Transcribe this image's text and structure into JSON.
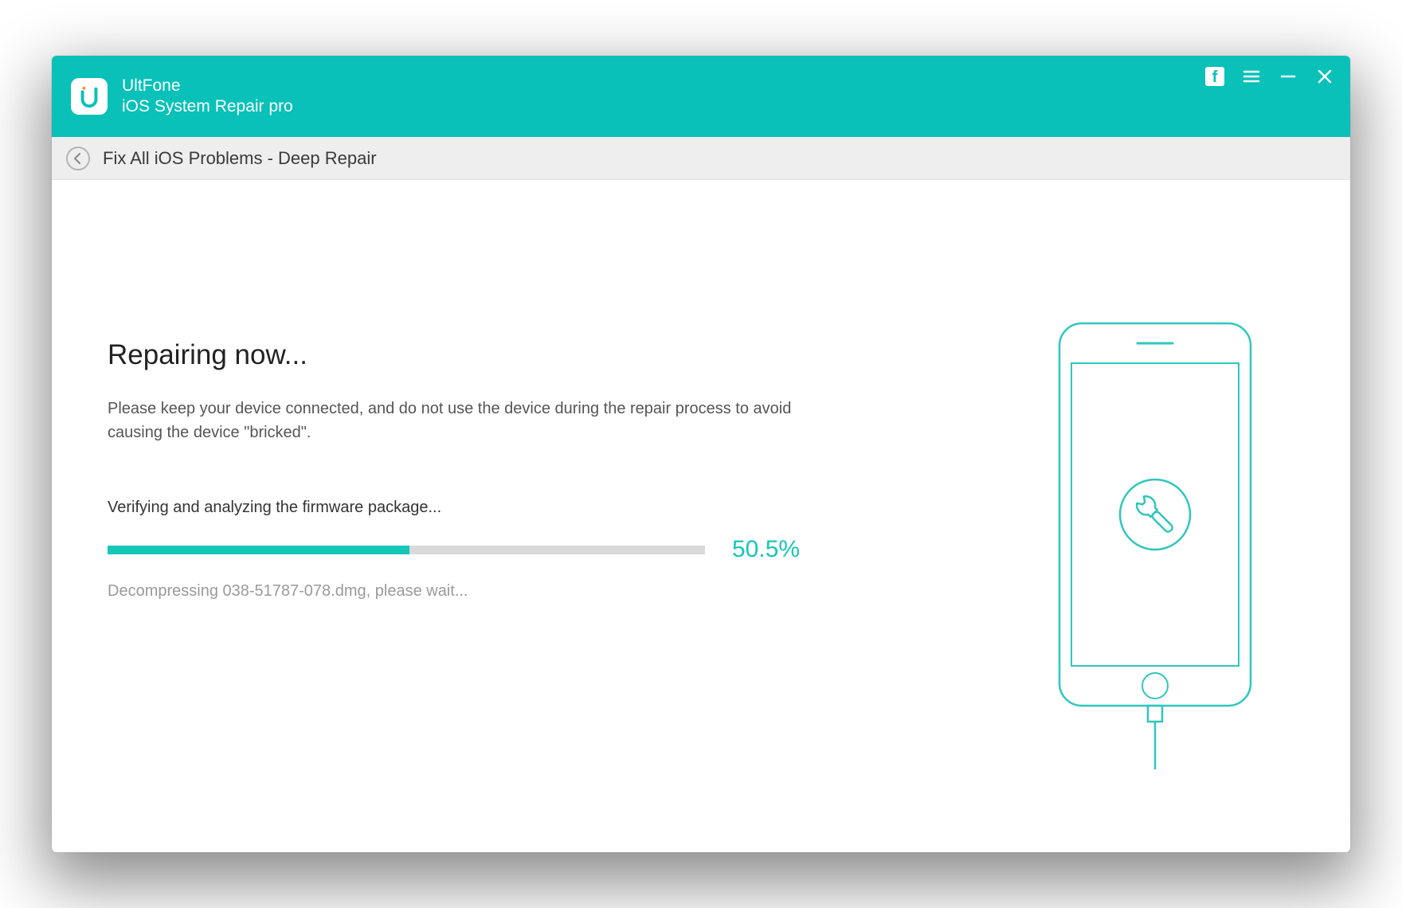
{
  "header": {
    "brand_top": "UltFone",
    "brand_bottom": "iOS System Repair pro"
  },
  "breadcrumb": {
    "text": "Fix All iOS Problems - Deep Repair"
  },
  "main": {
    "heading": "Repairing now...",
    "instruction": "Please keep your device connected, and do not use the device during the repair process to avoid causing the device \"bricked\".",
    "status_label": "Verifying and analyzing the firmware package...",
    "progress_percent": 50.5,
    "progress_percent_label": "50.5%",
    "detail": "Decompressing 038-51787-078.dmg, please wait..."
  },
  "colors": {
    "accent": "#09c1b8",
    "progress": "#16c7b8"
  }
}
